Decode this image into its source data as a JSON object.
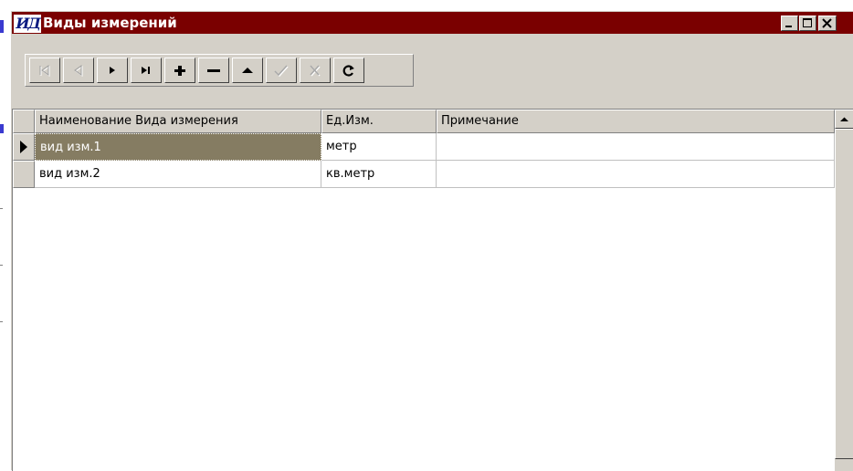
{
  "window": {
    "icon_text": "ИД",
    "title": "Виды измерений",
    "title_bar_color": "#7a0000",
    "controls": {
      "minimize": "_",
      "maximize": "□",
      "close": "×"
    }
  },
  "toolbar": {
    "buttons": [
      {
        "icon": "first-record-icon",
        "enabled": false
      },
      {
        "icon": "prior-record-icon",
        "enabled": false
      },
      {
        "icon": "next-record-icon",
        "enabled": true
      },
      {
        "icon": "last-record-icon",
        "enabled": true
      },
      {
        "icon": "insert-record-icon",
        "enabled": true
      },
      {
        "icon": "delete-record-icon",
        "enabled": true
      },
      {
        "icon": "edit-record-icon",
        "enabled": true
      },
      {
        "icon": "post-record-icon",
        "enabled": false
      },
      {
        "icon": "cancel-record-icon",
        "enabled": false
      },
      {
        "icon": "refresh-icon",
        "enabled": true
      }
    ]
  },
  "grid": {
    "columns": [
      "Наименование Вида измерения",
      "Ед.Изм.",
      "Примечание"
    ],
    "rows": [
      [
        "вид изм.1",
        "метр",
        ""
      ],
      [
        "вид изм.2",
        "кв.метр",
        ""
      ]
    ],
    "selected_row": 0,
    "selection_color": "#857c62"
  }
}
